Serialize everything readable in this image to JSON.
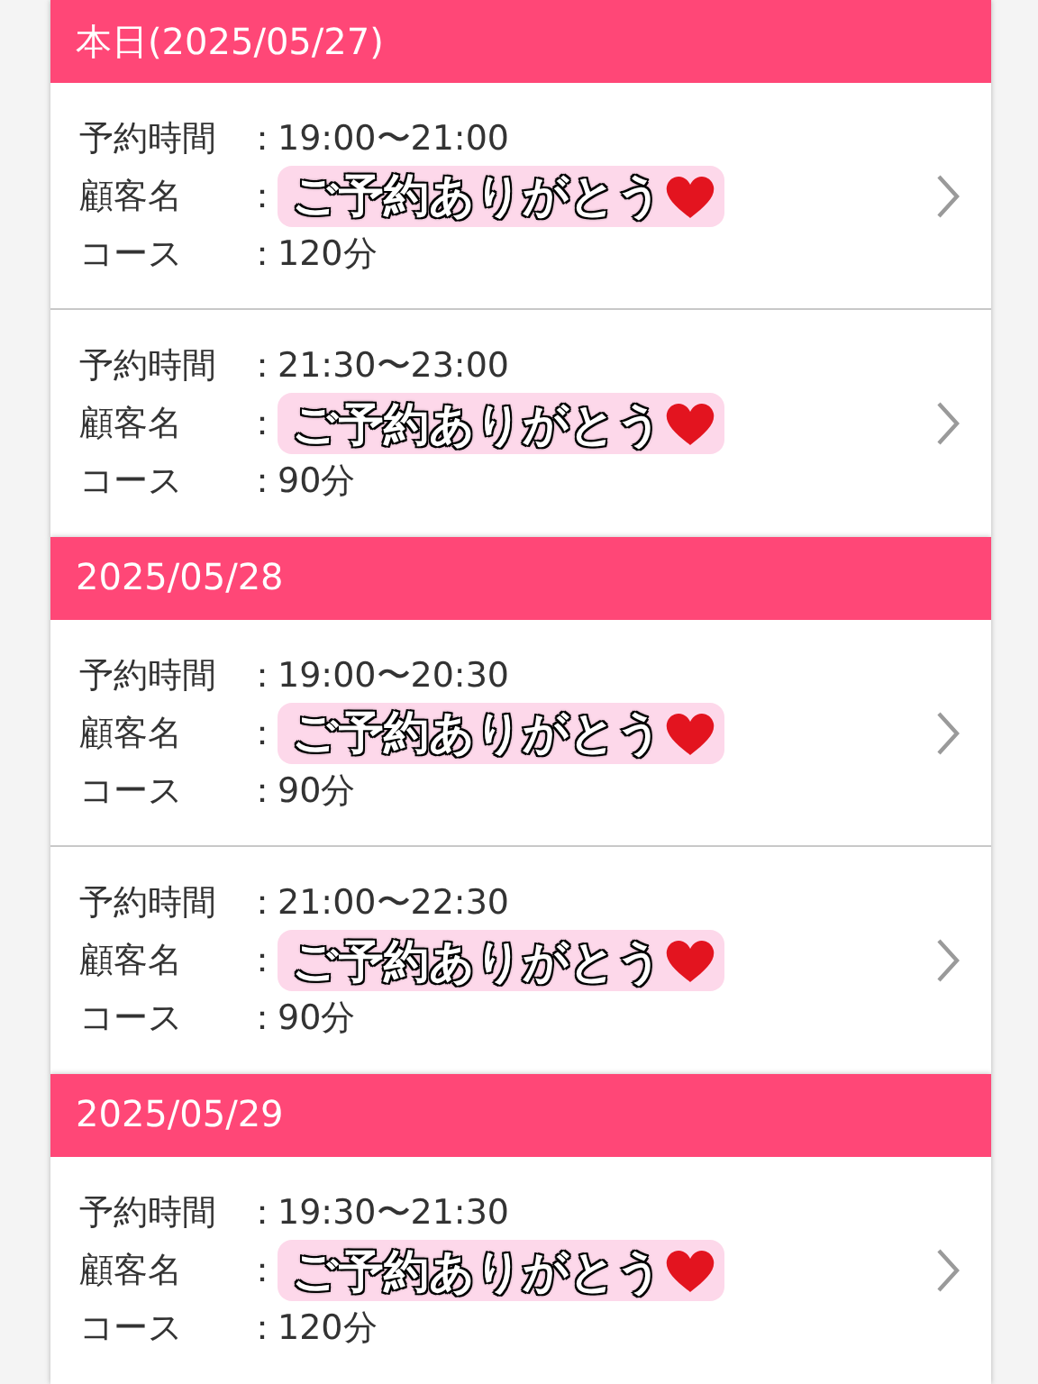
{
  "sections": [
    {
      "title": "本日(2025/05/27)",
      "rows": [
        {
          "fields": [
            {
              "kind": "text",
              "label": "予約時間",
              "colon": "：",
              "value": "19:00〜21:00"
            },
            {
              "kind": "sticker",
              "label": "顧客名",
              "colon": "：",
              "value": "ご予約ありがとう"
            },
            {
              "kind": "text",
              "label": "コース",
              "colon": "：",
              "value": "120分"
            }
          ]
        },
        {
          "fields": [
            {
              "kind": "text",
              "label": "予約時間",
              "colon": "：",
              "value": "21:30〜23:00"
            },
            {
              "kind": "sticker",
              "label": "顧客名",
              "colon": "：",
              "value": "ご予約ありがとう"
            },
            {
              "kind": "text",
              "label": "コース",
              "colon": "：",
              "value": "90分"
            }
          ]
        }
      ]
    },
    {
      "title": "2025/05/28",
      "rows": [
        {
          "fields": [
            {
              "kind": "text",
              "label": "予約時間",
              "colon": "：",
              "value": "19:00〜20:30"
            },
            {
              "kind": "sticker",
              "label": "顧客名",
              "colon": "：",
              "value": "ご予約ありがとう"
            },
            {
              "kind": "text",
              "label": "コース",
              "colon": "：",
              "value": "90分"
            }
          ]
        },
        {
          "fields": [
            {
              "kind": "text",
              "label": "予約時間",
              "colon": "：",
              "value": "21:00〜22:30"
            },
            {
              "kind": "sticker",
              "label": "顧客名",
              "colon": "：",
              "value": "ご予約ありがとう"
            },
            {
              "kind": "text",
              "label": "コース",
              "colon": "：",
              "value": "90分"
            }
          ]
        }
      ]
    },
    {
      "title": "2025/05/29",
      "rows": [
        {
          "fields": [
            {
              "kind": "text",
              "label": "予約時間",
              "colon": "：",
              "value": "19:30〜21:30"
            },
            {
              "kind": "sticker",
              "label": "顧客名",
              "colon": "：",
              "value": "ご予約ありがとう"
            },
            {
              "kind": "text",
              "label": "コース",
              "colon": "：",
              "value": "120分"
            }
          ]
        }
      ]
    }
  ]
}
